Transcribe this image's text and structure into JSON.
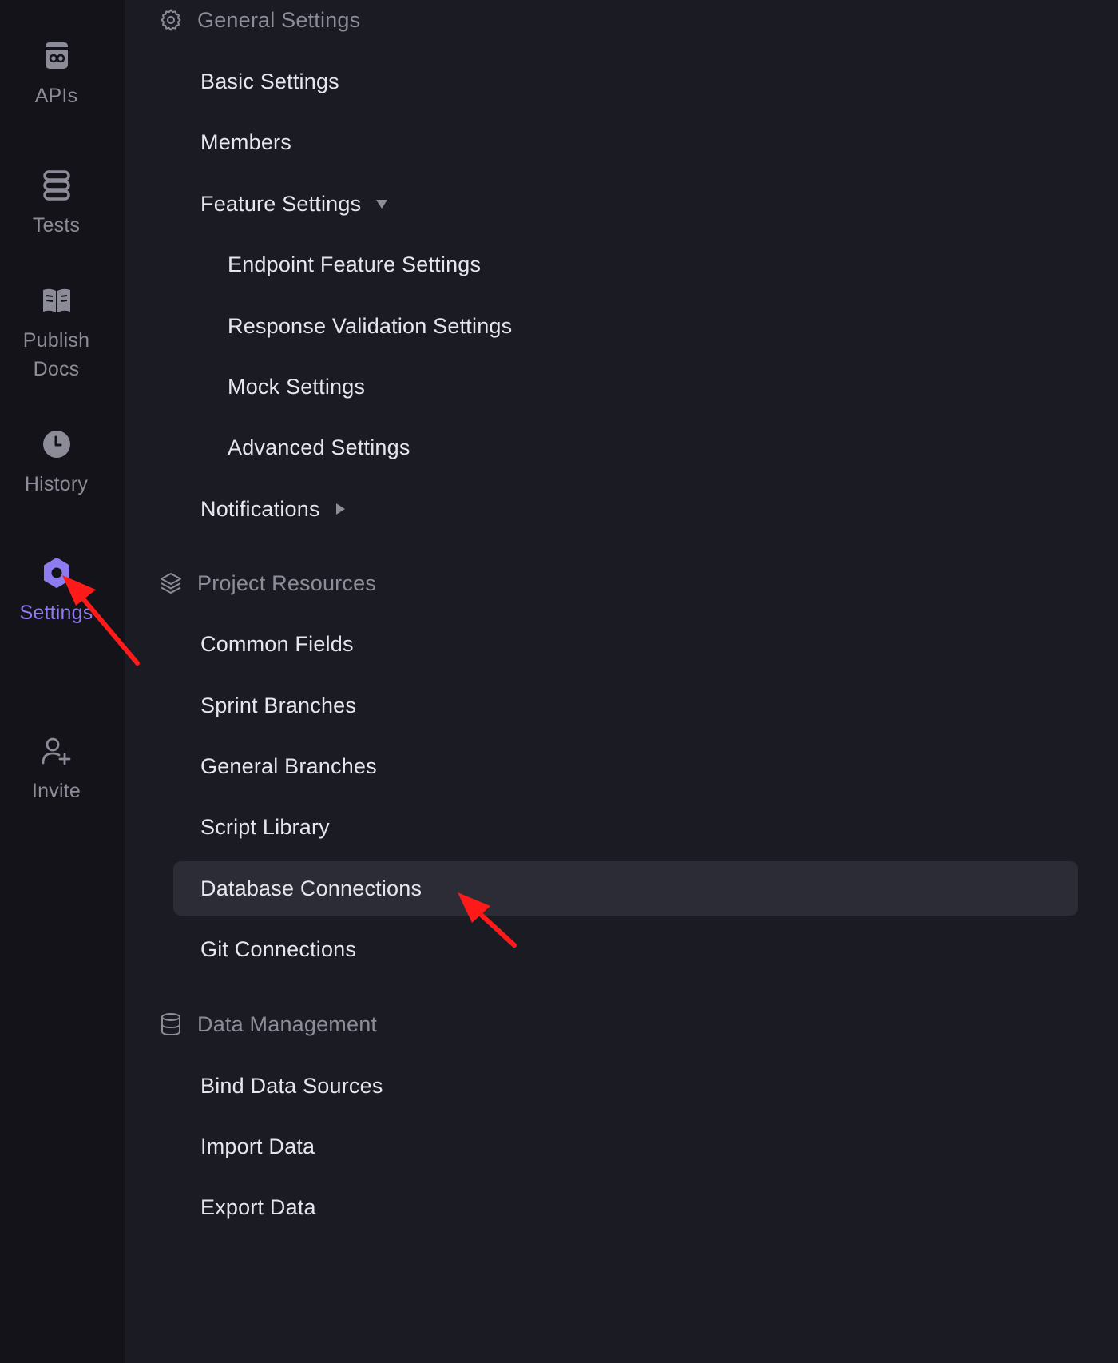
{
  "rail": {
    "items": [
      {
        "id": "apis",
        "label": "APIs",
        "icon": "api-icon"
      },
      {
        "id": "tests",
        "label": "Tests",
        "icon": "tests-icon"
      },
      {
        "id": "publish",
        "label": "Publish Docs",
        "icon": "book-icon"
      },
      {
        "id": "history",
        "label": "History",
        "icon": "clock-icon"
      },
      {
        "id": "settings",
        "label": "Settings",
        "icon": "settings-hexagon-icon",
        "active": true
      },
      {
        "id": "invite",
        "label": "Invite",
        "icon": "add-user-icon"
      }
    ]
  },
  "menu": {
    "general": {
      "title": "General Settings",
      "icon": "gear-icon",
      "items": {
        "basic": "Basic Settings",
        "members": "Members",
        "feature": "Feature Settings",
        "endpoint": "Endpoint Feature Settings",
        "response": "Response Validation Settings",
        "mock": "Mock Settings",
        "advanced": "Advanced Settings",
        "notifications": "Notifications"
      }
    },
    "resources": {
      "title": "Project Resources",
      "icon": "layers-icon",
      "items": {
        "common": "Common Fields",
        "sprint": "Sprint Branches",
        "general_branches": "General Branches",
        "script": "Script Library",
        "database": "Database Connections",
        "git": "Git Connections"
      }
    },
    "data": {
      "title": "Data Management",
      "icon": "database-icon",
      "items": {
        "bind": "Bind Data Sources",
        "import": "Import Data",
        "export": "Export Data"
      }
    },
    "selected": "Database Connections"
  },
  "colors": {
    "background": "#1b1b24",
    "rail_background": "#131319",
    "accent": "#8c7cf0",
    "selected_row": "#2c2c37",
    "annotation_arrow": "#ff1a1a"
  }
}
